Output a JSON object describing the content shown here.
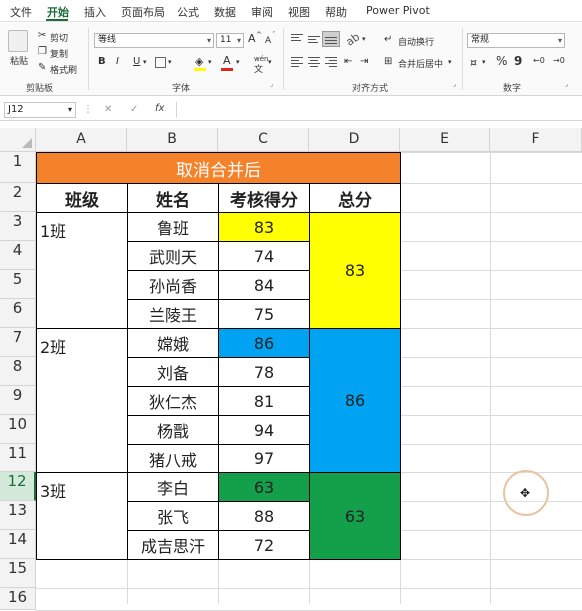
{
  "menu": {
    "tabs": [
      "文件",
      "开始",
      "插入",
      "页面布局",
      "公式",
      "数据",
      "审阅",
      "视图",
      "帮助",
      "Power Pivot"
    ],
    "active_tab": "开始"
  },
  "ribbon": {
    "clipboard": {
      "paste": "粘贴",
      "cut": "剪切",
      "copy": "复制",
      "format_painter": "格式刷",
      "label": "剪贴板"
    },
    "font": {
      "font_name": "等线",
      "font_size": "11",
      "bold": "B",
      "italic": "I",
      "underline": "U",
      "grow": "A",
      "shrink": "A",
      "font_color": "A",
      "wen": "wén",
      "label": "字体"
    },
    "alignment": {
      "wrap": "自动换行",
      "merge": "合并后居中",
      "label": "对齐方式"
    },
    "number": {
      "format": "常规",
      "percent": "%",
      "comma": "9",
      "label": "数字"
    }
  },
  "formula_bar": {
    "name_box": "J12",
    "cancel": "✕",
    "enter": "✓",
    "fx": "fx",
    "value": ""
  },
  "columns": [
    "A",
    "B",
    "C",
    "D",
    "E",
    "F"
  ],
  "rows": [
    "1",
    "2",
    "3",
    "4",
    "5",
    "6",
    "7",
    "8",
    "9",
    "10",
    "11",
    "12",
    "13",
    "14",
    "15",
    "16"
  ],
  "selected_row": "12",
  "sheet": {
    "title": "取消合并后",
    "headers": [
      "班级",
      "姓名",
      "考核得分",
      "总分"
    ],
    "classes": [
      {
        "name": "1班",
        "total": "83",
        "color": "#ffff00",
        "students": [
          {
            "name": "鲁班",
            "score": "83"
          },
          {
            "name": "武则天",
            "score": "74"
          },
          {
            "name": "孙尚香",
            "score": "84"
          },
          {
            "name": "兰陵王",
            "score": "75"
          }
        ]
      },
      {
        "name": "2班",
        "total": "86",
        "color": "#00a2f2",
        "students": [
          {
            "name": "嫦娥",
            "score": "86"
          },
          {
            "name": "刘备",
            "score": "78"
          },
          {
            "name": "狄仁杰",
            "score": "81"
          },
          {
            "name": "杨戬",
            "score": "94"
          },
          {
            "name": "猪八戒",
            "score": "97"
          }
        ]
      },
      {
        "name": "3班",
        "total": "63",
        "color": "#14a04b",
        "students": [
          {
            "name": "李白",
            "score": "63"
          },
          {
            "name": "张飞",
            "score": "88"
          },
          {
            "name": "成吉思汗",
            "score": "72"
          }
        ]
      }
    ]
  },
  "colors": {
    "title_fill": "#f4822a",
    "accent": "#1e6b3a"
  }
}
